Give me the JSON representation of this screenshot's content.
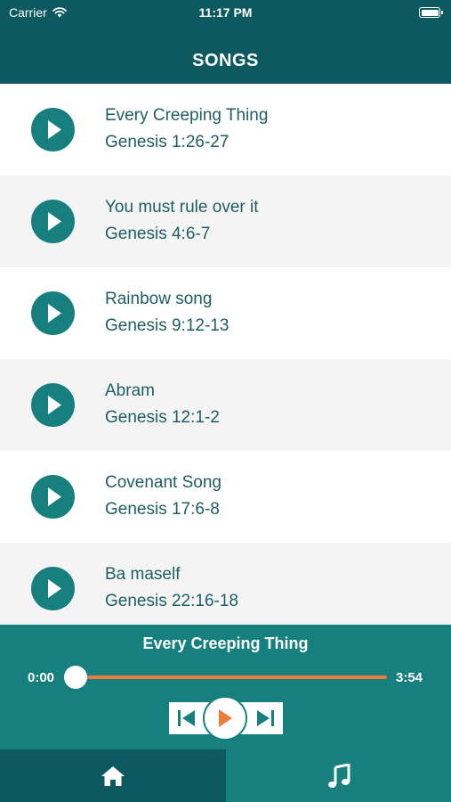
{
  "status_bar": {
    "carrier": "Carrier",
    "time": "11:17 PM"
  },
  "nav": {
    "title": "SONGS"
  },
  "songs": [
    {
      "title": "Every Creeping Thing",
      "reference": "Genesis 1:26-27"
    },
    {
      "title": "You must rule over it",
      "reference": "Genesis 4:6-7"
    },
    {
      "title": "Rainbow song",
      "reference": "Genesis 9:12-13"
    },
    {
      "title": "Abram",
      "reference": "Genesis 12:1-2"
    },
    {
      "title": "Covenant Song",
      "reference": "Genesis 17:6-8"
    },
    {
      "title": "Ba maself",
      "reference": "Genesis 22:16-18"
    }
  ],
  "player": {
    "now_playing": "Every Creeping Thing",
    "elapsed": "0:00",
    "duration": "3:54",
    "progress": 0
  },
  "tabs": [
    {
      "icon": "home-icon",
      "selected": true
    },
    {
      "icon": "music-note-icon",
      "selected": false
    }
  ],
  "colors": {
    "header": "#0c5a60",
    "accent": "#16807e",
    "text": "#1e5e62",
    "progress": "#ee7a3b",
    "row_alt": "#f4f4f4"
  }
}
